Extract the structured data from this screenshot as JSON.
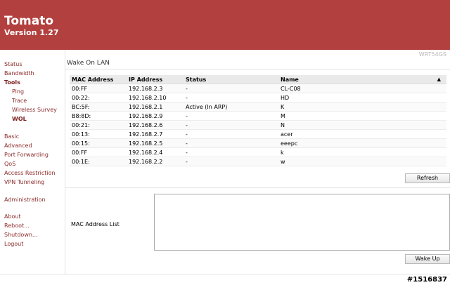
{
  "header": {
    "title": "Tomato",
    "version": "Version 1.27"
  },
  "model": "WRT54GS",
  "sidebar": [
    {
      "label": "Status"
    },
    {
      "label": "Bandwidth"
    },
    {
      "label": "Tools"
    },
    {
      "label": "Ping"
    },
    {
      "label": "Trace"
    },
    {
      "label": "Wireless Survey"
    },
    {
      "label": "WOL"
    },
    {
      "label": "Basic"
    },
    {
      "label": "Advanced"
    },
    {
      "label": "Port Forwarding"
    },
    {
      "label": "QoS"
    },
    {
      "label": "Access Restriction"
    },
    {
      "label": "VPN Tunneling"
    },
    {
      "label": "Administration"
    },
    {
      "label": "About"
    },
    {
      "label": "Reboot..."
    },
    {
      "label": "Shutdown..."
    },
    {
      "label": "Logout"
    }
  ],
  "section_title": "Wake On LAN",
  "table": {
    "headers": [
      "MAC Address",
      "IP Address",
      "Status",
      "Name"
    ],
    "rows": [
      {
        "mac": "00:FF",
        "ip": "192.168.2.3",
        "status": "-",
        "name": "CL-C08"
      },
      {
        "mac": "00:22:",
        "ip": "192.168.2.10",
        "status": "-",
        "name": "HD"
      },
      {
        "mac": "BC:5F:",
        "ip": "192.168.2.1",
        "status": "Active (In ARP)",
        "name": "K"
      },
      {
        "mac": "B8:8D:",
        "ip": "192.168.2.9",
        "status": "-",
        "name": "M"
      },
      {
        "mac": "00:21:",
        "ip": "192.168.2.6",
        "status": "-",
        "name": "N"
      },
      {
        "mac": "00:13:",
        "ip": "192.168.2.7",
        "status": "-",
        "name": "acer"
      },
      {
        "mac": "00:15:",
        "ip": "192.168.2.5",
        "status": "-",
        "name": "eeepc"
      },
      {
        "mac": "00:FF",
        "ip": "192.168.2.4",
        "status": "-",
        "name": "k"
      },
      {
        "mac": "00:1E:",
        "ip": "192.168.2.2",
        "status": "-",
        "name": "w"
      }
    ]
  },
  "buttons": {
    "refresh": "Refresh",
    "wake": "Wake Up"
  },
  "mac_list": {
    "label": "MAC Address List",
    "value": ""
  },
  "watermark": "#1516837",
  "icons": {
    "sort": "sort-up-icon"
  }
}
